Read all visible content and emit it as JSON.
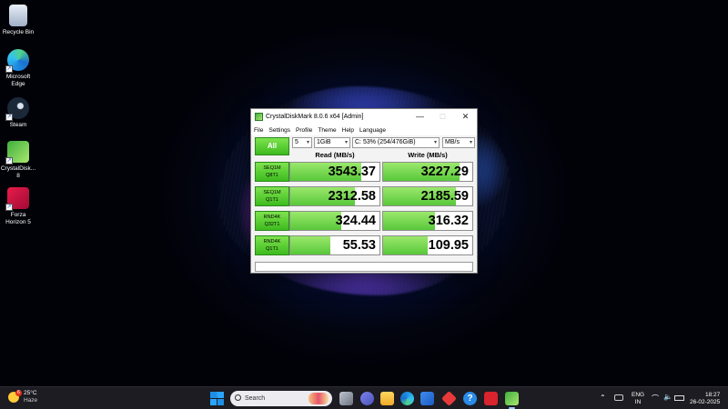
{
  "desktop": {
    "icons": [
      {
        "label": "Recycle Bin",
        "icon": "recycle-bin-icon"
      },
      {
        "label": "Microsoft Edge",
        "icon": "edge-icon"
      },
      {
        "label": "Steam",
        "icon": "steam-icon"
      },
      {
        "label": "CrystalDisk... 8",
        "icon": "crystaldiskmark-icon"
      },
      {
        "label": "Forza Horizon 5",
        "icon": "forza-icon"
      }
    ]
  },
  "window": {
    "title": "CrystalDiskMark 8.0.6 x64 [Admin]",
    "minimize": "—",
    "maximize": "□",
    "close": "✕",
    "menu": [
      "File",
      "Settings",
      "Profile",
      "Theme",
      "Help",
      "Language"
    ],
    "all_button": "All",
    "count": "5",
    "size": "1GiB",
    "drive": "C: 53% (254/476GiB)",
    "unit": "MB/s",
    "read_header": "Read (MB/s)",
    "write_header": "Write (MB/s)",
    "tests": [
      {
        "name": "SEQ1M",
        "param": "Q8T1",
        "read": "3543.37",
        "read_fill": 0.8,
        "write": "3227.29",
        "write_fill": 0.86
      },
      {
        "name": "SEQ1M",
        "param": "Q1T1",
        "read": "2312.58",
        "read_fill": 0.72,
        "write": "2185.59",
        "write_fill": 0.82
      },
      {
        "name": "RND4K",
        "param": "Q32T1",
        "read": "324.44",
        "read_fill": 0.57,
        "write": "316.32",
        "write_fill": 0.58
      },
      {
        "name": "RND4K",
        "param": "Q1T1",
        "read": "55.53",
        "read_fill": 0.45,
        "write": "109.95",
        "write_fill": 0.5
      }
    ],
    "comment": ""
  },
  "taskbar": {
    "weather_temp": "25°C",
    "weather_desc": "Haze",
    "weather_badge": "6",
    "search_placeholder": "Search",
    "language": "ENG",
    "region": "IN",
    "time": "18:27",
    "date": "26-02-2025"
  }
}
